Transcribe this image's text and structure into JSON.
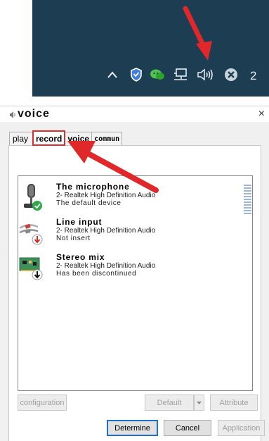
{
  "taskbar": {
    "clock_partial": "2",
    "tray_icons": [
      "chevron-up-icon",
      "shield-icon",
      "wechat-icon",
      "network-icon",
      "speaker-icon",
      "close-circle-icon"
    ]
  },
  "dialog": {
    "title": "voice",
    "close": "×",
    "tabs": [
      {
        "label": "play"
      },
      {
        "label": "record"
      },
      {
        "label": "voice"
      },
      {
        "label": "commun"
      }
    ],
    "devices": [
      {
        "name": "The microphone",
        "driver": "2- Realtek High Definition Audio",
        "status": "The default device",
        "badge": "check"
      },
      {
        "name": "Line input",
        "driver": "2- Realtek High Definition Audio",
        "status": "Not insert",
        "badge": "down-red"
      },
      {
        "name": "Stereo mix",
        "driver": "2- Realtek High Definition Audio",
        "status": "Has been discontinued",
        "badge": "down-black"
      }
    ],
    "buttons": {
      "configuration": "configuration",
      "default": "Default",
      "attribute": "Attribute",
      "determine": "Determine",
      "cancel": "Cancel",
      "application": "Application"
    }
  },
  "colors": {
    "annotation_red": "#e0282a",
    "taskbar_bg": "#1c3d52",
    "accent_blue": "#1f70c9"
  }
}
